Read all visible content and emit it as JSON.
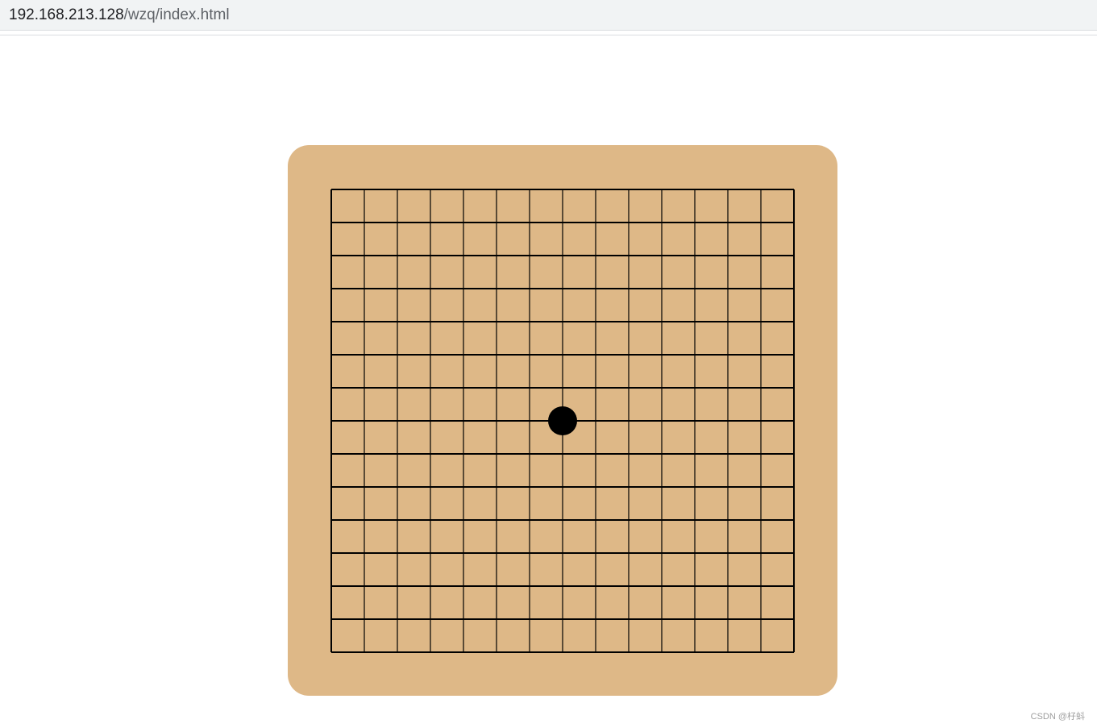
{
  "browser": {
    "url_host": "192.168.213.128",
    "url_path": "/wzq/index.html"
  },
  "game": {
    "board_color": "#DEB887",
    "line_color": "#000000",
    "grid_lines": 15,
    "stones": [
      {
        "color": "black",
        "col": 7,
        "row": 7
      }
    ]
  },
  "watermark": "CSDN @杍蚪"
}
